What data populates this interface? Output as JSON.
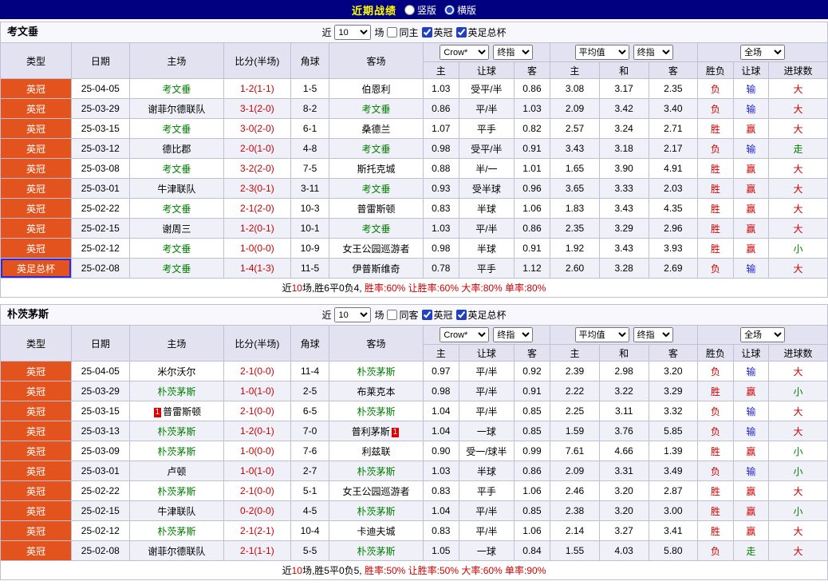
{
  "topbar": {
    "title": "近期战绩",
    "options": [
      {
        "label": "竖版",
        "selected": false
      },
      {
        "label": "横版",
        "selected": true
      }
    ]
  },
  "palette": {
    "topbar_bg": "#000080",
    "title_color": "#ffff00",
    "type_badge_bg": "#e2531d",
    "type_highlight_border": "#2a2ae0",
    "focus_team": "#008000",
    "score": "#cc0000",
    "red_card_bg": "#e00000",
    "header_bg": "#e2e2f0",
    "alt_row_bg": "#f0f0f8"
  },
  "value_colors": {
    "胜": "#cc0000",
    "负": "#cc0000",
    "赢": "#cc0000",
    "输": "#2222cc",
    "走": "#008000",
    "大": "#cc0000",
    "小": "#008000"
  },
  "tables": [
    {
      "team": "考文垂",
      "filter": {
        "prefix": "近",
        "count": "10",
        "suffix": "场",
        "checkboxes": [
          {
            "label": "同主",
            "checked": false
          },
          {
            "label": "英冠",
            "checked": true
          },
          {
            "label": "英足总杯",
            "checked": true
          }
        ]
      },
      "columns": [
        "类型",
        "日期",
        "主场",
        "比分(半场)",
        "角球",
        "客场"
      ],
      "odds_group1_selects": [
        "Crow*",
        "终指"
      ],
      "odds_group2_selects": [
        "平均值",
        "终指"
      ],
      "result_select": "全场",
      "sub_columns": [
        "主",
        "让球",
        "客",
        "主",
        "和",
        "客",
        "胜负",
        "让球",
        "进球数"
      ],
      "rows": [
        {
          "type": "英冠",
          "date": "25-04-05",
          "home": "考文垂",
          "home_focus": true,
          "score": "1-2(1-1)",
          "corners": "1-5",
          "away": "伯恩利",
          "away_focus": false,
          "odds1": [
            "1.03",
            "受平/半",
            "0.86"
          ],
          "odds2": [
            "3.08",
            "3.17",
            "2.35"
          ],
          "results": [
            "负",
            "输",
            "大"
          ]
        },
        {
          "type": "英冠",
          "date": "25-03-29",
          "home": "谢菲尔德联队",
          "home_focus": false,
          "score": "3-1(2-0)",
          "corners": "8-2",
          "away": "考文垂",
          "away_focus": true,
          "odds1": [
            "0.86",
            "平/半",
            "1.03"
          ],
          "odds2": [
            "2.09",
            "3.42",
            "3.40"
          ],
          "results": [
            "负",
            "输",
            "大"
          ]
        },
        {
          "type": "英冠",
          "date": "25-03-15",
          "home": "考文垂",
          "home_focus": true,
          "score": "3-0(2-0)",
          "corners": "6-1",
          "away": "桑德兰",
          "away_focus": false,
          "odds1": [
            "1.07",
            "平手",
            "0.82"
          ],
          "odds2": [
            "2.57",
            "3.24",
            "2.71"
          ],
          "results": [
            "胜",
            "赢",
            "大"
          ]
        },
        {
          "type": "英冠",
          "date": "25-03-12",
          "home": "德比郡",
          "home_focus": false,
          "score": "2-0(1-0)",
          "corners": "4-8",
          "away": "考文垂",
          "away_focus": true,
          "odds1": [
            "0.98",
            "受平/半",
            "0.91"
          ],
          "odds2": [
            "3.43",
            "3.18",
            "2.17"
          ],
          "results": [
            "负",
            "输",
            "走"
          ]
        },
        {
          "type": "英冠",
          "date": "25-03-08",
          "home": "考文垂",
          "home_focus": true,
          "score": "3-2(2-0)",
          "corners": "7-5",
          "away": "斯托克城",
          "away_focus": false,
          "odds1": [
            "0.88",
            "半/一",
            "1.01"
          ],
          "odds2": [
            "1.65",
            "3.90",
            "4.91"
          ],
          "results": [
            "胜",
            "赢",
            "大"
          ]
        },
        {
          "type": "英冠",
          "date": "25-03-01",
          "home": "牛津联队",
          "home_focus": false,
          "score": "2-3(0-1)",
          "corners": "3-11",
          "away": "考文垂",
          "away_focus": true,
          "odds1": [
            "0.93",
            "受半球",
            "0.96"
          ],
          "odds2": [
            "3.65",
            "3.33",
            "2.03"
          ],
          "results": [
            "胜",
            "赢",
            "大"
          ]
        },
        {
          "type": "英冠",
          "date": "25-02-22",
          "home": "考文垂",
          "home_focus": true,
          "score": "2-1(2-0)",
          "corners": "10-3",
          "away": "普雷斯顿",
          "away_focus": false,
          "odds1": [
            "0.83",
            "半球",
            "1.06"
          ],
          "odds2": [
            "1.83",
            "3.43",
            "4.35"
          ],
          "results": [
            "胜",
            "赢",
            "大"
          ]
        },
        {
          "type": "英冠",
          "date": "25-02-15",
          "home": "谢周三",
          "home_focus": false,
          "score": "1-2(0-1)",
          "corners": "10-1",
          "away": "考文垂",
          "away_focus": true,
          "odds1": [
            "1.03",
            "平/半",
            "0.86"
          ],
          "odds2": [
            "2.35",
            "3.29",
            "2.96"
          ],
          "results": [
            "胜",
            "赢",
            "大"
          ]
        },
        {
          "type": "英冠",
          "date": "25-02-12",
          "home": "考文垂",
          "home_focus": true,
          "score": "1-0(0-0)",
          "corners": "10-9",
          "away": "女王公园巡游者",
          "away_focus": false,
          "odds1": [
            "0.98",
            "半球",
            "0.91"
          ],
          "odds2": [
            "1.92",
            "3.43",
            "3.93"
          ],
          "results": [
            "胜",
            "赢",
            "小"
          ]
        },
        {
          "type": "英足总杯",
          "type_highlight": true,
          "date": "25-02-08",
          "home": "考文垂",
          "home_focus": true,
          "score": "1-4(1-3)",
          "corners": "11-5",
          "away": "伊普斯维奇",
          "away_focus": false,
          "odds1": [
            "0.78",
            "平手",
            "1.12"
          ],
          "odds2": [
            "2.60",
            "3.28",
            "2.69"
          ],
          "results": [
            "负",
            "输",
            "大"
          ]
        }
      ],
      "footer": {
        "pre": "近",
        "num": "10",
        "mid": "场,胜6平0负4, ",
        "stats": "胜率:60% 让胜率:60% 大率:80% 单率:80%"
      }
    },
    {
      "team": "朴茨茅斯",
      "filter": {
        "prefix": "近",
        "count": "10",
        "suffix": "场",
        "checkboxes": [
          {
            "label": "同客",
            "checked": false
          },
          {
            "label": "英冠",
            "checked": true
          },
          {
            "label": "英足总杯",
            "checked": true
          }
        ]
      },
      "columns": [
        "类型",
        "日期",
        "主场",
        "比分(半场)",
        "角球",
        "客场"
      ],
      "odds_group1_selects": [
        "Crow*",
        "终指"
      ],
      "odds_group2_selects": [
        "平均值",
        "终指"
      ],
      "result_select": "全场",
      "sub_columns": [
        "主",
        "让球",
        "客",
        "主",
        "和",
        "客",
        "胜负",
        "让球",
        "进球数"
      ],
      "rows": [
        {
          "type": "英冠",
          "date": "25-04-05",
          "home": "米尔沃尔",
          "home_focus": false,
          "score": "2-1(0-0)",
          "corners": "11-4",
          "away": "朴茨茅斯",
          "away_focus": true,
          "odds1": [
            "0.97",
            "平/半",
            "0.92"
          ],
          "odds2": [
            "2.39",
            "2.98",
            "3.20"
          ],
          "results": [
            "负",
            "输",
            "大"
          ]
        },
        {
          "type": "英冠",
          "date": "25-03-29",
          "home": "朴茨茅斯",
          "home_focus": true,
          "score": "1-0(1-0)",
          "corners": "2-5",
          "away": "布莱克本",
          "away_focus": false,
          "odds1": [
            "0.98",
            "平/半",
            "0.91"
          ],
          "odds2": [
            "2.22",
            "3.22",
            "3.29"
          ],
          "results": [
            "胜",
            "赢",
            "小"
          ]
        },
        {
          "type": "英冠",
          "date": "25-03-15",
          "home": "普雷斯顿",
          "home_focus": false,
          "home_rc": "1",
          "home_rc_pos": "before",
          "score": "2-1(0-0)",
          "corners": "6-5",
          "away": "朴茨茅斯",
          "away_focus": true,
          "odds1": [
            "1.04",
            "平/半",
            "0.85"
          ],
          "odds2": [
            "2.25",
            "3.11",
            "3.32"
          ],
          "results": [
            "负",
            "输",
            "大"
          ]
        },
        {
          "type": "英冠",
          "date": "25-03-13",
          "home": "朴茨茅斯",
          "home_focus": true,
          "score": "1-2(0-1)",
          "corners": "7-0",
          "away": "普利茅斯",
          "away_focus": false,
          "away_rc": "1",
          "away_rc_pos": "after",
          "odds1": [
            "1.04",
            "一球",
            "0.85"
          ],
          "odds2": [
            "1.59",
            "3.76",
            "5.85"
          ],
          "results": [
            "负",
            "输",
            "大"
          ]
        },
        {
          "type": "英冠",
          "date": "25-03-09",
          "home": "朴茨茅斯",
          "home_focus": true,
          "score": "1-0(0-0)",
          "corners": "7-6",
          "away": "利兹联",
          "away_focus": false,
          "odds1": [
            "0.90",
            "受一/球半",
            "0.99"
          ],
          "odds2": [
            "7.61",
            "4.66",
            "1.39"
          ],
          "results": [
            "胜",
            "赢",
            "小"
          ]
        },
        {
          "type": "英冠",
          "date": "25-03-01",
          "home": "卢顿",
          "home_focus": false,
          "score": "1-0(1-0)",
          "corners": "2-7",
          "away": "朴茨茅斯",
          "away_focus": true,
          "odds1": [
            "1.03",
            "半球",
            "0.86"
          ],
          "odds2": [
            "2.09",
            "3.31",
            "3.49"
          ],
          "results": [
            "负",
            "输",
            "小"
          ]
        },
        {
          "type": "英冠",
          "date": "25-02-22",
          "home": "朴茨茅斯",
          "home_focus": true,
          "score": "2-1(0-0)",
          "corners": "5-1",
          "away": "女王公园巡游者",
          "away_focus": false,
          "odds1": [
            "0.83",
            "平手",
            "1.06"
          ],
          "odds2": [
            "2.46",
            "3.20",
            "2.87"
          ],
          "results": [
            "胜",
            "赢",
            "大"
          ]
        },
        {
          "type": "英冠",
          "date": "25-02-15",
          "home": "牛津联队",
          "home_focus": false,
          "score": "0-2(0-0)",
          "corners": "4-5",
          "away": "朴茨茅斯",
          "away_focus": true,
          "odds1": [
            "1.04",
            "平/半",
            "0.85"
          ],
          "odds2": [
            "2.38",
            "3.20",
            "3.00"
          ],
          "results": [
            "胜",
            "赢",
            "小"
          ]
        },
        {
          "type": "英冠",
          "date": "25-02-12",
          "home": "朴茨茅斯",
          "home_focus": true,
          "score": "2-1(2-1)",
          "corners": "10-4",
          "away": "卡迪夫城",
          "away_focus": false,
          "odds1": [
            "0.83",
            "平/半",
            "1.06"
          ],
          "odds2": [
            "2.14",
            "3.27",
            "3.41"
          ],
          "results": [
            "胜",
            "赢",
            "大"
          ]
        },
        {
          "type": "英冠",
          "date": "25-02-08",
          "home": "谢菲尔德联队",
          "home_focus": false,
          "score": "2-1(1-1)",
          "corners": "5-5",
          "away": "朴茨茅斯",
          "away_focus": true,
          "odds1": [
            "1.05",
            "一球",
            "0.84"
          ],
          "odds2": [
            "1.55",
            "4.03",
            "5.80"
          ],
          "results": [
            "负",
            "走",
            "大"
          ]
        }
      ],
      "footer": {
        "pre": "近",
        "num": "10",
        "mid": "场,胜5平0负5, ",
        "stats": "胜率:50% 让胜率:50% 大率:60% 单率:90%"
      }
    }
  ]
}
